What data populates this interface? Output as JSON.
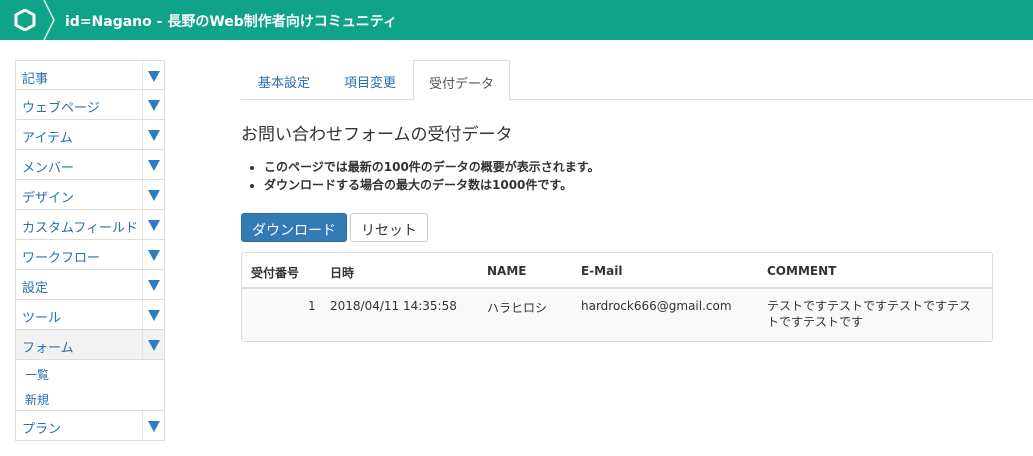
{
  "header": {
    "title": "id=Nagano - 長野のWeb制作者向けコミュニティ"
  },
  "sidebar": {
    "items": [
      {
        "label": "記事"
      },
      {
        "label": "ウェブページ"
      },
      {
        "label": "アイテム"
      },
      {
        "label": "メンバー"
      },
      {
        "label": "デザイン"
      },
      {
        "label": "カスタムフィールド"
      },
      {
        "label": "ワークフロー"
      },
      {
        "label": "設定"
      },
      {
        "label": "ツール"
      },
      {
        "label": "フォーム"
      },
      {
        "label": "プラン"
      }
    ],
    "form_submenu": [
      {
        "label": "一覧"
      },
      {
        "label": "新規"
      }
    ]
  },
  "tabs": [
    {
      "label": "基本設定"
    },
    {
      "label": "項目変更"
    },
    {
      "label": "受付データ"
    }
  ],
  "main": {
    "title": "お問い合わせフォームの受付データ",
    "notes": [
      "このページでは最新の100件のデータの概要が表示されます。",
      "ダウンロードする場合の最大のデータ数は1000件です。"
    ],
    "download_label": "ダウンロード",
    "reset_label": "リセット"
  },
  "table": {
    "columns": [
      "受付番号",
      "日時",
      "NAME",
      "E-Mail",
      "COMMENT"
    ],
    "rows": [
      {
        "id": "1",
        "datetime": "2018/04/11 14:35:58",
        "name": "ハラヒロシ",
        "email": "hardrock666@gmail.com",
        "comment": "テストですテストですテストですテストですテストです"
      }
    ]
  },
  "colors": {
    "header_bg": "#0fa48a",
    "link": "#2a6fb0",
    "primary_button": "#337ab7"
  }
}
